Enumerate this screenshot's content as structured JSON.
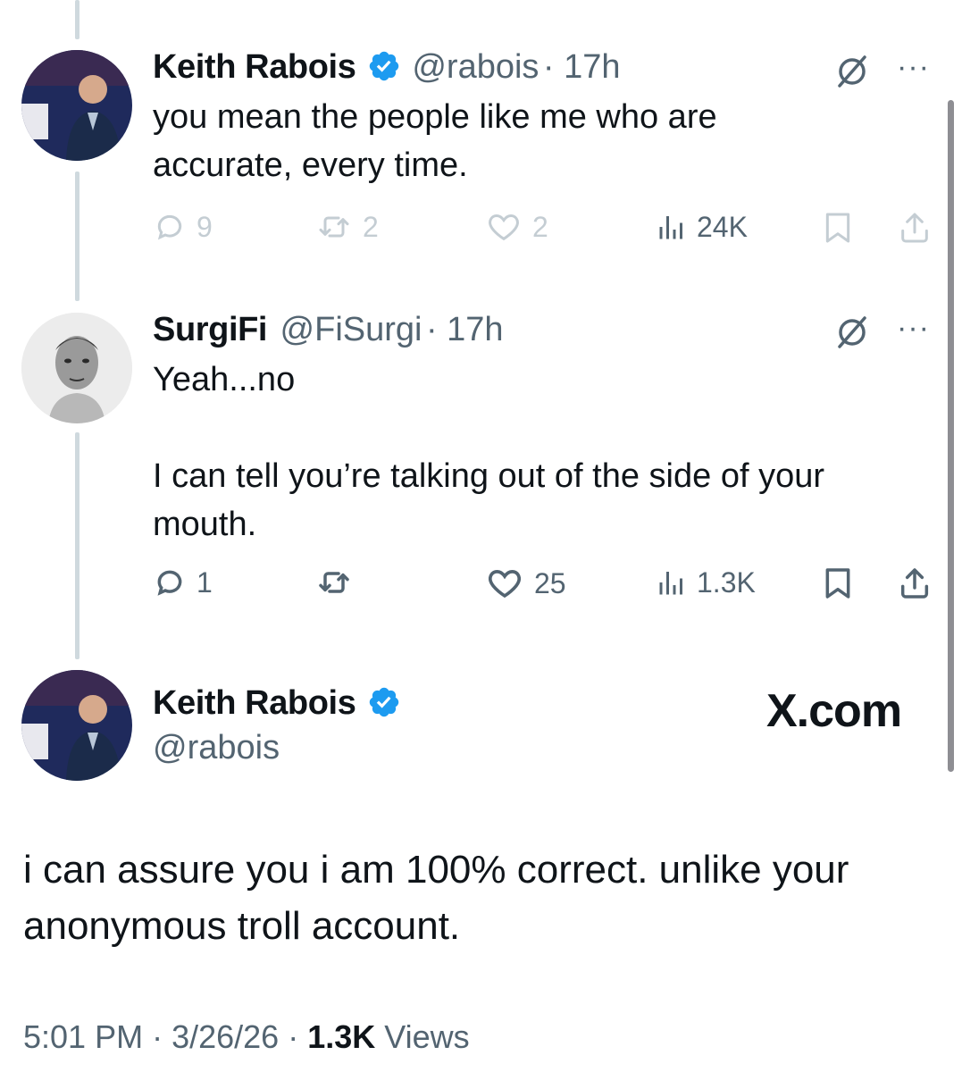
{
  "tweet1": {
    "name": "Keith Rabois",
    "handle": "@rabois",
    "time": "· 17h",
    "text_line1": "you mean the people like me who are",
    "text_line2": "accurate, every time.",
    "replies": "9",
    "retweets": "2",
    "likes": "2",
    "views": "24K"
  },
  "tweet2": {
    "name": "SurgiFi",
    "handle": "@FiSurgi",
    "time": "· 17h",
    "text_line1": "Yeah...no",
    "text_line2": "I can tell you’re talking out of the side of your",
    "text_line3": "mouth.",
    "replies": "1",
    "likes": "25",
    "views": "1.3K"
  },
  "main_tweet": {
    "name": "Keith Rabois",
    "handle": "@rabois",
    "brand": "X.com",
    "text": "i can assure you i am 100% correct.  unlike your anonymous troll account.",
    "time": "5:01 PM",
    "date": "3/26/26",
    "views_count": "1.3K",
    "views_label": "Views"
  },
  "colors": {
    "verified": "#1d9bf0",
    "secondary_text": "#536471",
    "thread_line": "#cfd9de"
  }
}
